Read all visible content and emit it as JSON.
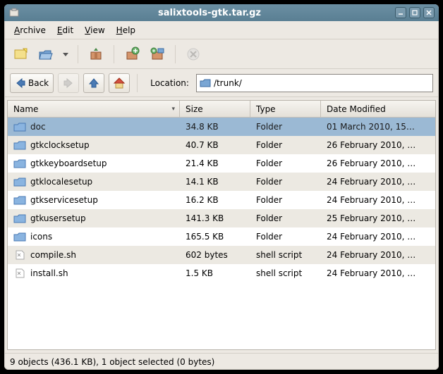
{
  "window": {
    "title": "salixtools-gtk.tar.gz"
  },
  "menu": {
    "archive": "Archive",
    "edit": "Edit",
    "view": "View",
    "help": "Help"
  },
  "nav": {
    "back": "Back",
    "location_label": "Location:",
    "path": "/trunk/"
  },
  "columns": {
    "name": "Name",
    "size": "Size",
    "type": "Type",
    "date": "Date Modified"
  },
  "files": [
    {
      "name": "doc",
      "size": "34.8 KB",
      "type": "Folder",
      "date": "01 March 2010, 15…",
      "icon": "folder",
      "selected": true
    },
    {
      "name": "gtkclocksetup",
      "size": "40.7 KB",
      "type": "Folder",
      "date": "26 February 2010, …",
      "icon": "folder"
    },
    {
      "name": "gtkkeyboardsetup",
      "size": "21.4 KB",
      "type": "Folder",
      "date": "26 February 2010, …",
      "icon": "folder"
    },
    {
      "name": "gtklocalesetup",
      "size": "14.1 KB",
      "type": "Folder",
      "date": "24 February 2010, …",
      "icon": "folder"
    },
    {
      "name": "gtkservicesetup",
      "size": "16.2 KB",
      "type": "Folder",
      "date": "24 February 2010, …",
      "icon": "folder"
    },
    {
      "name": "gtkusersetup",
      "size": "141.3 KB",
      "type": "Folder",
      "date": "25 February 2010, …",
      "icon": "folder"
    },
    {
      "name": "icons",
      "size": "165.5 KB",
      "type": "Folder",
      "date": "24 February 2010, …",
      "icon": "folder"
    },
    {
      "name": "compile.sh",
      "size": "602 bytes",
      "type": "shell script",
      "date": "24 February 2010, …",
      "icon": "script"
    },
    {
      "name": "install.sh",
      "size": "1.5 KB",
      "type": "shell script",
      "date": "24 February 2010, …",
      "icon": "script"
    }
  ],
  "status": "9 objects (436.1 KB), 1 object selected (0 bytes)"
}
